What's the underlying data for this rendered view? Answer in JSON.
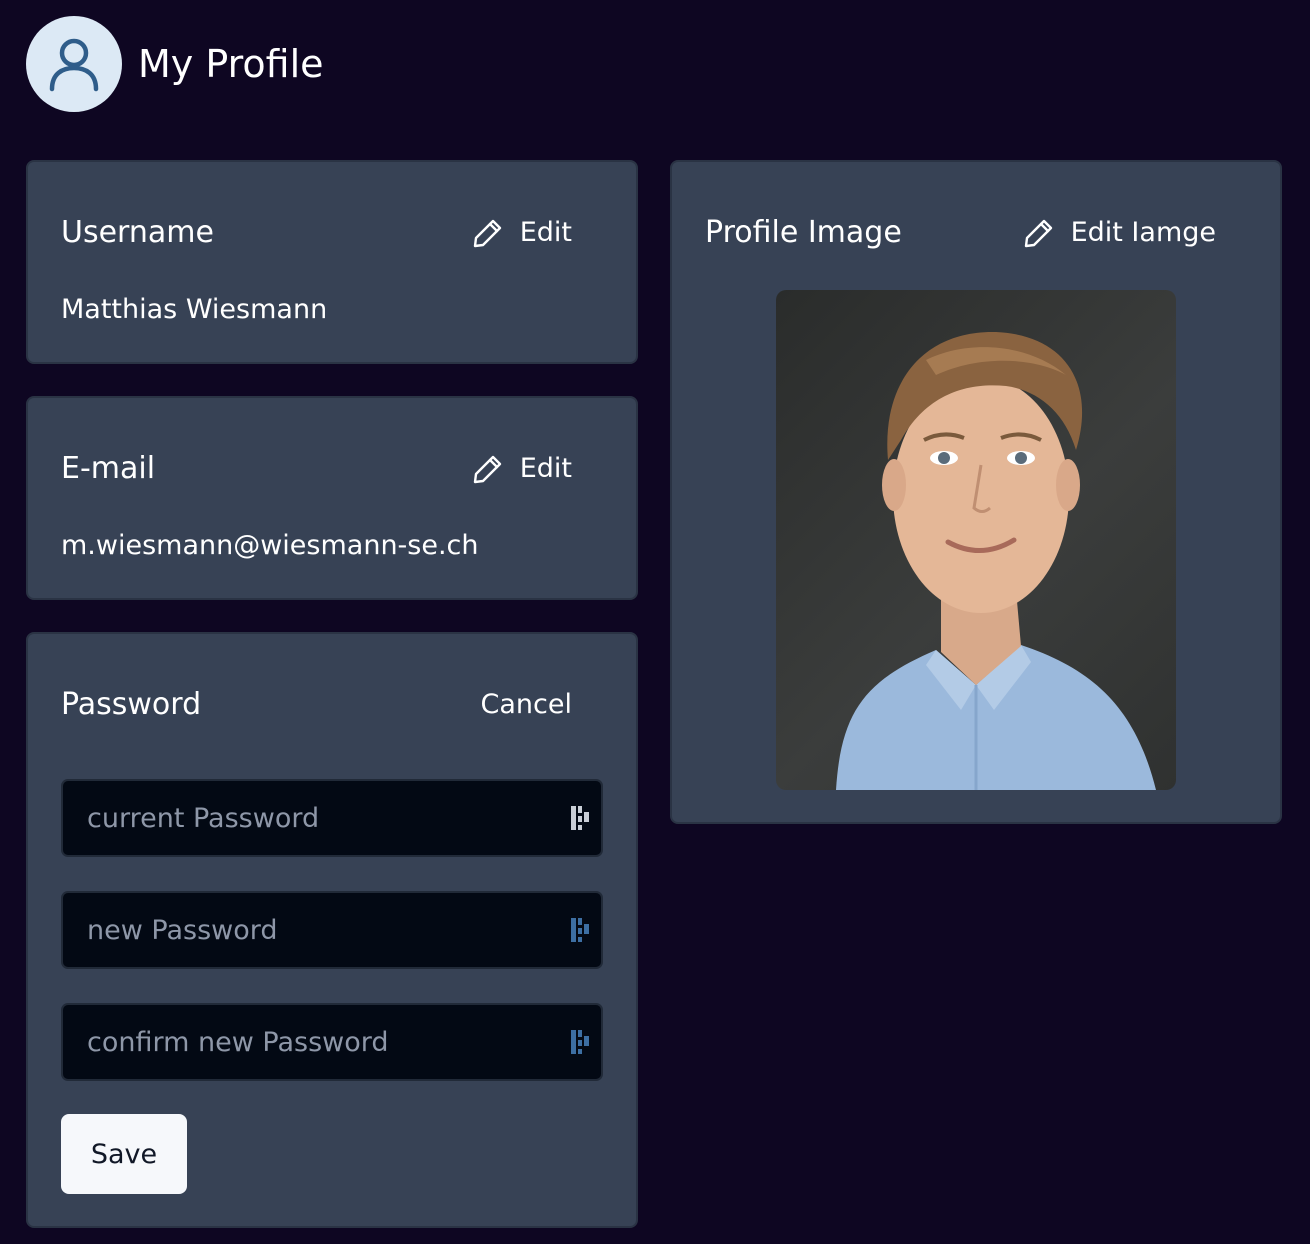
{
  "header": {
    "title": "My Profile",
    "avatar_icon": "user-icon"
  },
  "username": {
    "title": "Username",
    "edit_label": "Edit",
    "value": "Matthias Wiesmann"
  },
  "email": {
    "title": "E-mail",
    "edit_label": "Edit",
    "value": "m.wiesmann@wiesmann-se.ch"
  },
  "password": {
    "title": "Password",
    "cancel_label": "Cancel",
    "current_placeholder": "current Password",
    "new_placeholder": "new Password",
    "confirm_placeholder": "confirm new Password",
    "save_label": "Save"
  },
  "profile_image": {
    "title": "Profile Image",
    "edit_label": "Edit Iamge"
  },
  "colors": {
    "background": "#0e0622",
    "card": "#374255",
    "input": "#030914",
    "avatar_bg": "#dce9f5",
    "avatar_icon": "#2f5d8a"
  }
}
